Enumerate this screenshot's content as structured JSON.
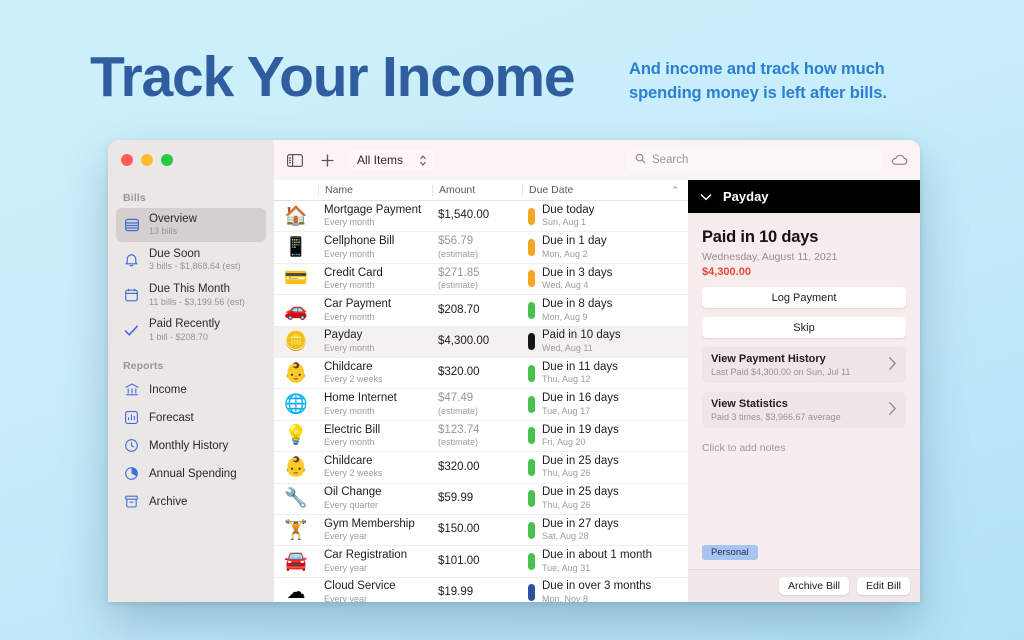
{
  "hero": {
    "headline": "Track Your Income",
    "subhead_line1": "And income and track how much",
    "subhead_line2": "spending money is left after bills."
  },
  "toolbar": {
    "sidebar_toggle_icon": "sidebar-icon",
    "add_icon": "plus-icon",
    "filter_label": "All Items",
    "search_placeholder": "Search",
    "search_value": "",
    "cloud_icon": "cloud-icon"
  },
  "sidebar": {
    "group_bills": "Bills",
    "group_reports": "Reports",
    "bills": [
      {
        "label": "Overview",
        "sub": "13 bills",
        "icon": "list-icon",
        "selected": true
      },
      {
        "label": "Due Soon",
        "sub": "3 bills - $1,868.64 (est)",
        "icon": "bell-icon",
        "selected": false
      },
      {
        "label": "Due This Month",
        "sub": "11 bills - $3,199.56 (est)",
        "icon": "calendar-icon",
        "selected": false
      },
      {
        "label": "Paid Recently",
        "sub": "1 bill - $208.70",
        "icon": "checkmark-icon",
        "selected": false
      }
    ],
    "reports": [
      {
        "label": "Income",
        "icon": "bank-icon"
      },
      {
        "label": "Forecast",
        "icon": "bar-chart-icon"
      },
      {
        "label": "Monthly History",
        "icon": "clock-icon"
      },
      {
        "label": "Annual Spending",
        "icon": "pie-chart-icon"
      },
      {
        "label": "Archive",
        "icon": "archive-icon"
      }
    ]
  },
  "list": {
    "columns": {
      "name": "Name",
      "amount": "Amount",
      "due_date": "Due Date"
    },
    "sort_caret": "⌃",
    "rows": [
      {
        "icon": "🏠",
        "name": "Mortgage Payment",
        "frequency": "Every month",
        "amount": "$1,540.00",
        "amount_note": "",
        "estimate": false,
        "due_main": "Due today",
        "due_sub": "Sun, Aug 1",
        "pill": "#f5a623",
        "selected": false
      },
      {
        "icon": "📱",
        "name": "Cellphone Bill",
        "frequency": "Every month",
        "amount": "$56.79",
        "amount_note": "(estimate)",
        "estimate": true,
        "due_main": "Due in 1 day",
        "due_sub": "Mon, Aug 2",
        "pill": "#f5a623",
        "selected": false
      },
      {
        "icon": "💳",
        "name": "Credit Card",
        "frequency": "Every month",
        "amount": "$271.85",
        "amount_note": "(estimate)",
        "estimate": true,
        "due_main": "Due in 3 days",
        "due_sub": "Wed, Aug 4",
        "pill": "#f5a623",
        "selected": false
      },
      {
        "icon": "🚗",
        "name": "Car Payment",
        "frequency": "Every month",
        "amount": "$208.70",
        "amount_note": "",
        "estimate": false,
        "due_main": "Due in 8 days",
        "due_sub": "Mon, Aug 9",
        "pill": "#49c14f",
        "selected": false
      },
      {
        "icon": "🪙",
        "name": "Payday",
        "frequency": "Every month",
        "amount": "$4,300.00",
        "amount_note": "",
        "estimate": false,
        "due_main": "Paid in 10 days",
        "due_sub": "Wed, Aug 11",
        "pill": "#141414",
        "selected": true
      },
      {
        "icon": "👶",
        "name": "Childcare",
        "frequency": "Every 2 weeks",
        "amount": "$320.00",
        "amount_note": "",
        "estimate": false,
        "due_main": "Due in 11 days",
        "due_sub": "Thu, Aug 12",
        "pill": "#49c14f",
        "selected": false
      },
      {
        "icon": "🌐",
        "name": "Home Internet",
        "frequency": "Every month",
        "amount": "$47.49",
        "amount_note": "(estimate)",
        "estimate": true,
        "due_main": "Due in 16 days",
        "due_sub": "Tue, Aug 17",
        "pill": "#49c14f",
        "selected": false
      },
      {
        "icon": "💡",
        "name": "Electric Bill",
        "frequency": "Every month",
        "amount": "$123.74",
        "amount_note": "(estimate)",
        "estimate": true,
        "due_main": "Due in 19 days",
        "due_sub": "Fri, Aug 20",
        "pill": "#49c14f",
        "selected": false
      },
      {
        "icon": "👶",
        "name": "Childcare",
        "frequency": "Every 2 weeks",
        "amount": "$320.00",
        "amount_note": "",
        "estimate": false,
        "due_main": "Due in 25 days",
        "due_sub": "Thu, Aug 26",
        "pill": "#49c14f",
        "selected": false
      },
      {
        "icon": "🔧",
        "name": "Oil Change",
        "frequency": "Every quarter",
        "amount": "$59.99",
        "amount_note": "",
        "estimate": false,
        "due_main": "Due in 25 days",
        "due_sub": "Thu, Aug 26",
        "pill": "#49c14f",
        "selected": false
      },
      {
        "icon": "🏋",
        "name": "Gym Membership",
        "frequency": "Every year",
        "amount": "$150.00",
        "amount_note": "",
        "estimate": false,
        "due_main": "Due in 27 days",
        "due_sub": "Sat, Aug 28",
        "pill": "#49c14f",
        "selected": false
      },
      {
        "icon": "🚘",
        "name": "Car Registration",
        "frequency": "Every year",
        "amount": "$101.00",
        "amount_note": "",
        "estimate": false,
        "due_main": "Due in about 1 month",
        "due_sub": "Tue, Aug 31",
        "pill": "#49c14f",
        "selected": false
      },
      {
        "icon": "☁",
        "name": "Cloud Service",
        "frequency": "Every year",
        "amount": "$19.99",
        "amount_note": "",
        "estimate": false,
        "due_main": "Due in over 3 months",
        "due_sub": "Mon, Nov 8",
        "pill": "#2d52a0",
        "selected": false
      }
    ]
  },
  "detail": {
    "header_title": "Payday",
    "collapse_icon": "chevron-down-icon",
    "status": "Paid in 10 days",
    "date": "Wednesday, August 11, 2021",
    "amount": "$4,300.00",
    "log_payment_label": "Log Payment",
    "skip_label": "Skip",
    "cards": [
      {
        "title": "View Payment History",
        "sub": "Last Paid $4,300.00 on Sun, Jul 11"
      },
      {
        "title": "View Statistics",
        "sub": "Paid 3 times, $3,966.67 average"
      }
    ],
    "notes_placeholder": "Click to add notes",
    "tag": "Personal",
    "archive_label": "Archive Bill",
    "edit_label": "Edit Bill"
  },
  "colors": {
    "accent_blue": "#2f5d9e",
    "sub_blue": "#2b7fd4",
    "amount_red": "#e8453c",
    "pill_orange": "#f5a623",
    "pill_green": "#49c14f",
    "pill_blue": "#2d52a0",
    "pill_black": "#141414"
  }
}
